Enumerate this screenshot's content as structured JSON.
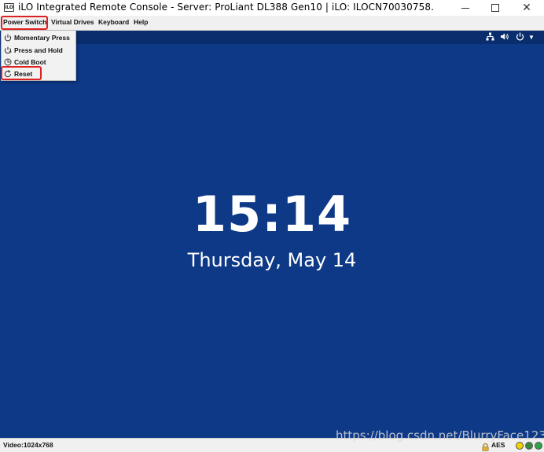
{
  "window": {
    "title": "iLO Integrated Remote Console - Server: ProLiant DL388 Gen10 | iLO: ILOCN70030758.",
    "app_icon_text": "iLO",
    "controls": {
      "minimize": "minimize-icon",
      "maximize": "maximize-icon",
      "close": "close-icon"
    }
  },
  "menubar": {
    "items": [
      {
        "label": "Power Switch",
        "highlighted": true
      },
      {
        "label": "Virtual Drives"
      },
      {
        "label": "Keyboard"
      },
      {
        "label": "Help"
      }
    ]
  },
  "power_menu": {
    "items": [
      {
        "label": "Momentary Press",
        "icon": "power-icon"
      },
      {
        "label": "Press and Hold",
        "icon": "hold-icon"
      },
      {
        "label": "Cold Boot",
        "icon": "cold-boot-icon"
      },
      {
        "label": "Reset",
        "icon": "reset-icon",
        "highlighted": true
      }
    ]
  },
  "remote_screen": {
    "time": "15:14",
    "date": "Thursday, May 14",
    "tray_icons": [
      "network-icon",
      "volume-icon",
      "power-icon",
      "caret-down-icon"
    ],
    "background_color": "#0d3987"
  },
  "statusbar": {
    "video": "Video:1024x768",
    "encryption": "AES",
    "indicators": [
      {
        "name": "indicator-yellow",
        "color": "#f2d200"
      },
      {
        "name": "indicator-dark-green",
        "color": "#3a8a3a"
      },
      {
        "name": "indicator-green",
        "color": "#2fa34a"
      }
    ]
  },
  "watermark": "https://blog.csdn.net/BlurryFace123",
  "colors": {
    "highlight": "#e02020",
    "screen_bg": "#0d3987"
  }
}
